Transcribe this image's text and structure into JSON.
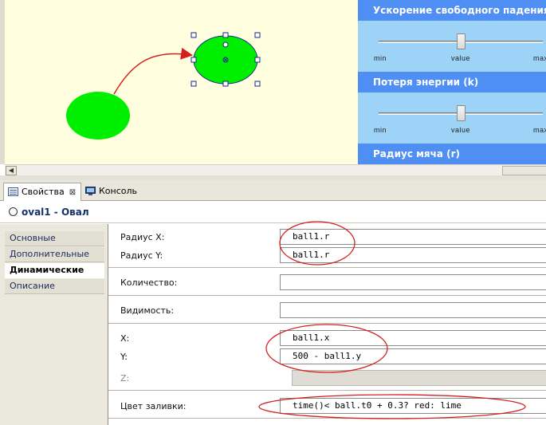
{
  "panel": {
    "sections": [
      {
        "title": "Ускорение свободного падения  (g)",
        "min": "min",
        "value": "value",
        "max": "max"
      },
      {
        "title": "Потеря энергии  (k)",
        "min": "min",
        "value": "value",
        "max": "max"
      },
      {
        "title": "Радиус мяча  (r)"
      }
    ]
  },
  "tabs": [
    {
      "label": "Свойства",
      "close": "⊠"
    },
    {
      "label": "Консоль"
    }
  ],
  "title": "oval1 - Овал",
  "nav": [
    "Основные",
    "Дополнительные",
    "Динамические",
    "Описание"
  ],
  "props": {
    "radius_x": {
      "label": "Радиус X:",
      "value": "ball1.r"
    },
    "radius_y": {
      "label": "Радиус Y:",
      "value": "ball1.r"
    },
    "count": {
      "label": "Количество:",
      "value": ""
    },
    "visibility": {
      "label": "Видимость:",
      "value": ""
    },
    "x": {
      "label": "X:",
      "value": "ball1.x"
    },
    "y": {
      "label": "Y:",
      "value": "500 - ball1.y"
    },
    "z": {
      "label": "Z:",
      "value": ""
    },
    "fill": {
      "label": "Цвет заливки:",
      "value": "time()< ball.t0 + 0.3? red: lime"
    }
  },
  "colors": {
    "ball": "#00ee00",
    "arrow": "#d42020",
    "annotation": "#d42020",
    "header": "#4f8ff3",
    "panel_body": "#9cd3f7"
  }
}
